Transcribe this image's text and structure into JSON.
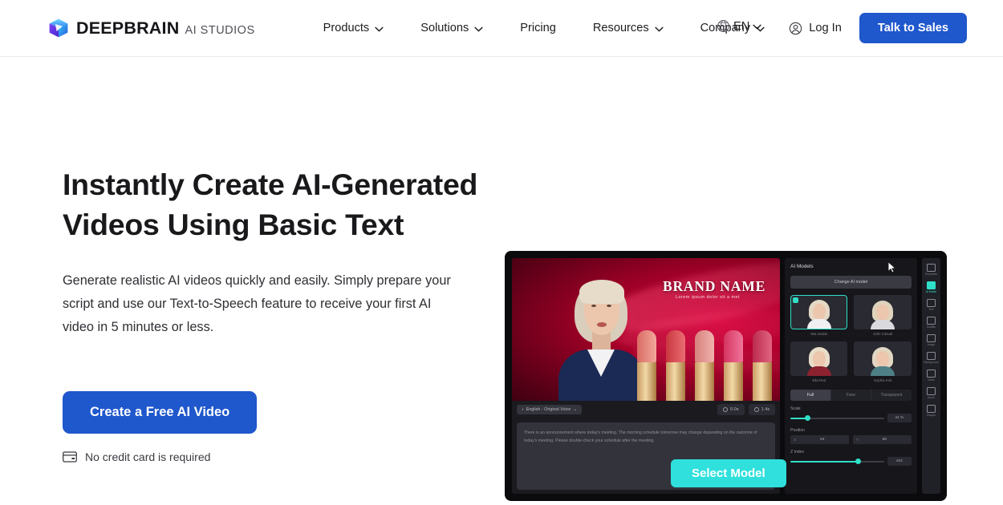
{
  "header": {
    "logo": {
      "icon": "cube-logo-icon",
      "brand": "DEEPBRAIN",
      "sub": "AI STUDIOS"
    },
    "nav": [
      {
        "label": "Products",
        "has_dropdown": true
      },
      {
        "label": "Solutions",
        "has_dropdown": true
      },
      {
        "label": "Pricing",
        "has_dropdown": false
      },
      {
        "label": "Resources",
        "has_dropdown": true
      },
      {
        "label": "Company",
        "has_dropdown": true
      }
    ],
    "language": {
      "icon": "globe-icon",
      "label": "EN"
    },
    "login": {
      "icon": "user-circle-icon",
      "label": "Log In"
    },
    "cta": {
      "label": "Talk to Sales",
      "color": "#1f57cc"
    }
  },
  "hero": {
    "title": "Instantly Create AI-Generated Videos Using Basic Text",
    "subtitle": "Generate realistic AI videos quickly and easily. Simply prepare your script and use our Text-to-Speech feature to receive your first AI video in 5 minutes or less.",
    "cta_label": "Create a Free AI Video",
    "note_icon": "credit-card-icon",
    "note": "No credit card is required"
  },
  "mock": {
    "stage": {
      "brand_name": "BRAND NAME",
      "brand_sub": "Lorem ipsum dolor sit a met"
    },
    "toolbar": {
      "voice_chip": "English - Original Voice",
      "duration": "0.0s",
      "total": "1.4s"
    },
    "script": "There is an announcement where today's meeting. The morning schedule tomorrow may change depending on the outcome of today's meeting. Please double-check your schedule after the meeting.",
    "panel": {
      "title": "AI Models",
      "change_button": "Change AI model",
      "models": [
        {
          "name": "Mia Sedan",
          "selected": true
        },
        {
          "name": "John Casual",
          "selected": false
        },
        {
          "name": "Ella Red",
          "selected": false
        },
        {
          "name": "Sophia Knit",
          "selected": false
        }
      ],
      "segments": [
        {
          "label": "Full",
          "active": true
        },
        {
          "label": "Face",
          "active": false
        },
        {
          "label": "Transparent",
          "active": false
        }
      ],
      "controls": {
        "scale_label": "Scale",
        "scale_value": "44 %",
        "scale_pct": 18,
        "position_label": "Position",
        "position_x_axis": "X",
        "position_x": "24",
        "position_y_axis": "Y",
        "position_y": "60",
        "zindex_label": "Z Index",
        "zindex_value": "404",
        "zindex_pct": 72
      }
    },
    "rail": [
      {
        "label": "Templates",
        "active": false
      },
      {
        "label": "AI Model",
        "active": true
      },
      {
        "label": "Text",
        "active": false
      },
      {
        "label": "Subtitle",
        "active": false
      },
      {
        "label": "Image",
        "active": false
      },
      {
        "label": "Background",
        "active": false
      },
      {
        "label": "Video",
        "active": false
      },
      {
        "label": "Audio",
        "active": false
      },
      {
        "label": "Shapes",
        "active": false
      }
    ],
    "select_model_button": "Select Model",
    "accent_color": "#2fe0c8"
  }
}
